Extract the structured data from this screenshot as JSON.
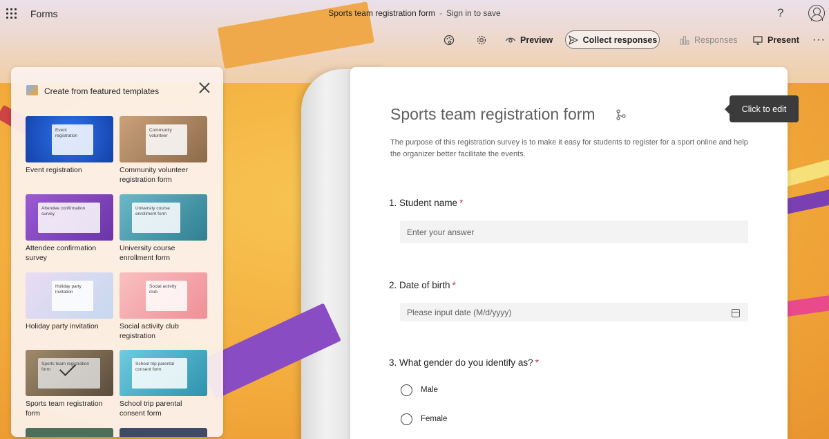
{
  "app": {
    "name": "Forms"
  },
  "header": {
    "doc_title": "Sports team registration form",
    "separator": "-",
    "sign_in": "Sign in to save",
    "help": "?"
  },
  "toolbar": {
    "preview": "Preview",
    "collect": "Collect responses",
    "responses": "Responses",
    "present": "Present",
    "more": "···"
  },
  "templates_panel": {
    "title": "Create from featured templates",
    "items": [
      {
        "label": "Event registration",
        "card": "Event registration",
        "color": "#1e5bd8"
      },
      {
        "label": "Community volunteer registration form",
        "card": "Community volunteer",
        "color": "#b88f66"
      },
      {
        "label": "Attendee confirmation survey",
        "card": "Attendee confirmation survey",
        "color": "#8a4cc2"
      },
      {
        "label": "University course enrollment form",
        "card": "University course enrollment form",
        "color": "#4f99a8"
      },
      {
        "label": "Holiday party invitation",
        "card": "Holiday party invitation",
        "color": "#d9c7e8"
      },
      {
        "label": "Social activity club registration",
        "card": "Social activity club",
        "color": "#f4a3a6"
      },
      {
        "label": "Sports team registration form",
        "card": "Sports team registration form",
        "color": "#7a6c55"
      },
      {
        "label": "School trip parental consent form",
        "card": "School trip parental consent form",
        "color": "#4fb0c6"
      }
    ]
  },
  "form": {
    "title": "Sports team registration form",
    "description": "The purpose of this registration survey is to make it easy for students to register for a sport online and help the organizer better facilitate the events.",
    "tooltip": "Click to edit",
    "questions": [
      {
        "label": "1. Student name",
        "required": "*",
        "placeholder": "Enter your answer"
      },
      {
        "label": "2. Date of birth",
        "required": "*",
        "placeholder": "Please input date (M/d/yyyy)"
      },
      {
        "label": "3. What gender do you identify as?",
        "required": "*",
        "options": [
          "Male",
          "Female"
        ]
      }
    ]
  }
}
